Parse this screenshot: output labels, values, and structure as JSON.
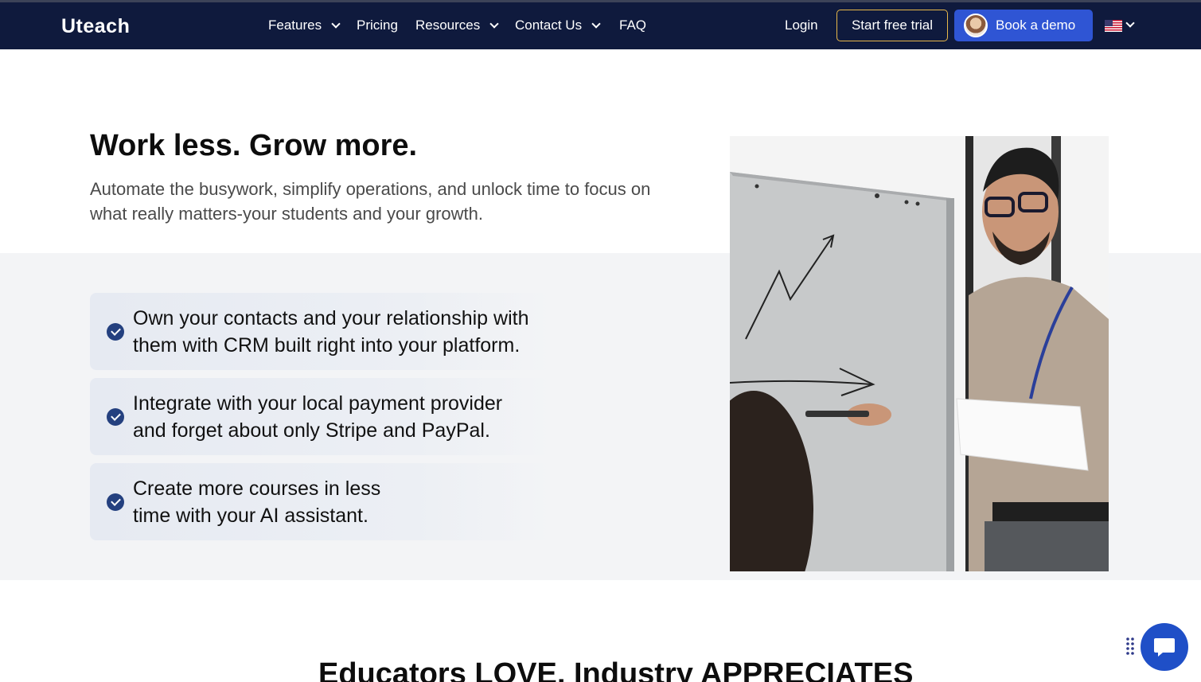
{
  "header": {
    "logo": "Uteach",
    "nav": [
      {
        "label": "Features"
      },
      {
        "label": "Pricing"
      },
      {
        "label": "Resources"
      },
      {
        "label": "Contact Us"
      },
      {
        "label": "FAQ"
      }
    ],
    "login_label": "Login",
    "trial_label": "Start free trial",
    "demo_label": "Book a demo",
    "language_icon": "us-flag-icon"
  },
  "hero": {
    "title": "Work less. Grow more.",
    "subtitle": "Automate the busywork, simplify operations, and unlock time to focus on what really matters-your students and your growth.",
    "features": [
      {
        "line1": "Own your contacts and your relationship with",
        "line2": "them with CRM built right into your platform."
      },
      {
        "line1": "Integrate with your local payment provider",
        "line2": "and forget about only Stripe and PayPal."
      },
      {
        "line1": "Create more courses in less",
        "line2": "time with your AI assistant."
      }
    ]
  },
  "section2": {
    "title": "Educators LOVE, Industry APPRECIATES"
  },
  "colors": {
    "nav_bg": "#0f1a3d",
    "accent_blue": "#2f55d4",
    "trial_border": "#e8b84a",
    "check_blue": "#24407f"
  }
}
